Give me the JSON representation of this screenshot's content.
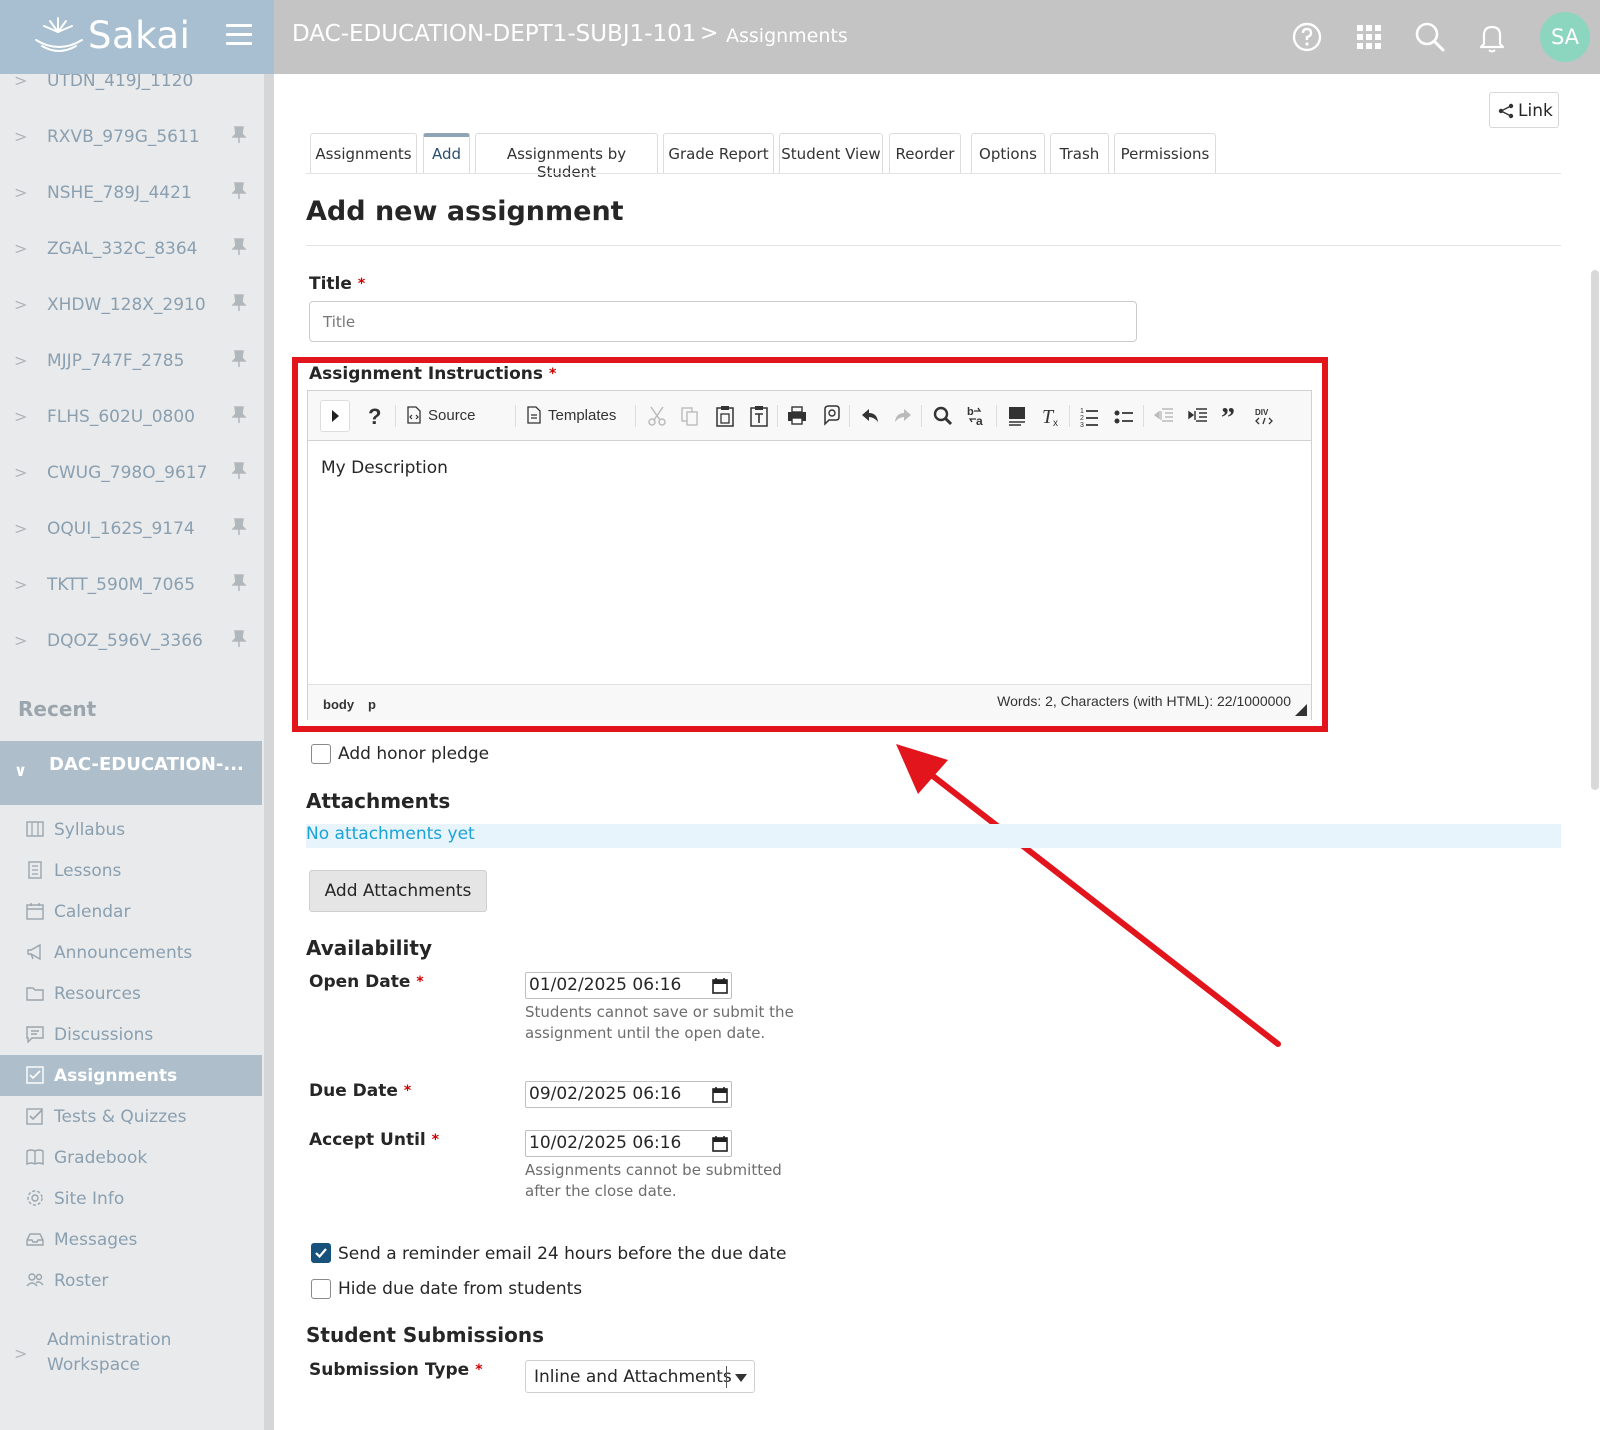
{
  "header": {
    "logo_text": "Sakai",
    "site_title": "DAC-EDUCATION-DEPT1-SUBJ1-101",
    "crumb_sep": ">",
    "tool_title": "Assignments",
    "avatar_initials": "SA"
  },
  "sidebar": {
    "sites": [
      {
        "label": "UTDN_419J_1120"
      },
      {
        "label": "RXVB_979G_5611"
      },
      {
        "label": "NSHE_789J_4421"
      },
      {
        "label": "ZGAL_332C_8364"
      },
      {
        "label": "XHDW_128X_2910"
      },
      {
        "label": "MJJP_747F_2785"
      },
      {
        "label": "FLHS_602U_0800"
      },
      {
        "label": "CWUG_798O_9617"
      },
      {
        "label": "OQUI_162S_9174"
      },
      {
        "label": "TKTT_590M_7065"
      },
      {
        "label": "DQOZ_596V_3366"
      }
    ],
    "recent_label": "Recent",
    "current_site": "DAC-EDUCATION-...",
    "tools": [
      {
        "label": "Syllabus",
        "icon": "syllabus-icon"
      },
      {
        "label": "Lessons",
        "icon": "lessons-icon"
      },
      {
        "label": "Calendar",
        "icon": "calendar-icon"
      },
      {
        "label": "Announcements",
        "icon": "megaphone-icon"
      },
      {
        "label": "Resources",
        "icon": "folder-icon"
      },
      {
        "label": "Discussions",
        "icon": "discussions-icon"
      },
      {
        "label": "Assignments",
        "icon": "assignments-icon",
        "active": true
      },
      {
        "label": "Tests & Quizzes",
        "icon": "quiz-icon"
      },
      {
        "label": "Gradebook",
        "icon": "gradebook-icon"
      },
      {
        "label": "Site Info",
        "icon": "gear-icon"
      },
      {
        "label": "Messages",
        "icon": "inbox-icon"
      },
      {
        "label": "Roster",
        "icon": "people-icon"
      }
    ],
    "admin_label": "Administration Workspace"
  },
  "main": {
    "link_button": "Link",
    "tabs": [
      {
        "label": "Assignments"
      },
      {
        "label": "Add",
        "active": true
      },
      {
        "label": "Assignments by Student"
      },
      {
        "label": "Grade Report"
      },
      {
        "label": "Student View"
      },
      {
        "label": "Reorder"
      },
      {
        "label": "Options"
      },
      {
        "label": "Trash"
      },
      {
        "label": "Permissions"
      }
    ],
    "page_title": "Add new assignment",
    "title_label": "Title",
    "title_placeholder": "Title",
    "required_mark": "*",
    "instructions_label": "Assignment Instructions",
    "editor": {
      "source_label": "Source",
      "templates_label": "Templates",
      "content": "My Description",
      "path": [
        "body",
        "p"
      ],
      "word_count": "Words: 2, Characters (with HTML): 22/1000000"
    },
    "honor_pledge_label": "Add honor pledge",
    "attachments_header": "Attachments",
    "no_attachments": "No attachments yet",
    "add_attachments_button": "Add Attachments",
    "availability_header": "Availability",
    "open_date_label": "Open Date",
    "open_date_value": "01/02/2025 06:16",
    "open_date_help": "Students cannot save or submit the assignment until the open date.",
    "due_date_label": "Due Date",
    "due_date_value": "09/02/2025 06:16",
    "accept_until_label": "Accept Until",
    "accept_until_value": "10/02/2025 06:16",
    "accept_until_help": "Assignments cannot be submitted after the close date.",
    "reminder_label": "Send a reminder email 24 hours before the due date",
    "reminder_checked": true,
    "hide_due_label": "Hide due date from students",
    "hide_due_checked": false,
    "submissions_header": "Student Submissions",
    "submission_type_label": "Submission Type",
    "submission_type_value": "Inline and Attachments"
  },
  "colors": {
    "highlight": "#e2151d",
    "brand_bg": "#a7bfd0",
    "header_bg": "#c3c4c3",
    "active_item": "#aebfcb",
    "link": "#1aa3d7",
    "checkbox": "#17527d"
  }
}
